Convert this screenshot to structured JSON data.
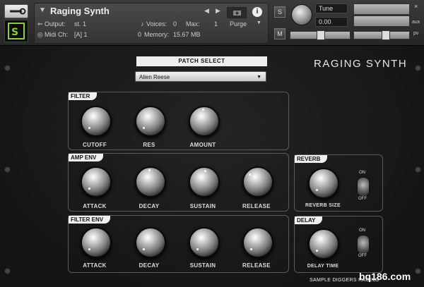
{
  "header": {
    "instrument_name": "Raging Synth",
    "output_label": "Output:",
    "output_value": "st. 1",
    "midi_label": "Midi Ch:",
    "midi_value": "[A]  1",
    "voices_label": "Voices:",
    "voices_value": "0",
    "max_label": "Max:",
    "max_value": "1",
    "memory_label": "Memory:",
    "memory_prefix": "0",
    "memory_value": "15.67 MB",
    "purge_label": "Purge",
    "s_label": "S",
    "m_label": "M",
    "tune_label": "Tune",
    "tune_value": "0.00",
    "aux_label": "aux",
    "pv_label": "pv"
  },
  "panel": {
    "title": "RAGING SYNTH",
    "patch_select_label": "PATCH SELECT",
    "patch_value": "Alien Reese",
    "filter": {
      "label": "FILTER",
      "knobs": [
        "CUTOFF",
        "RES",
        "AMOUNT"
      ]
    },
    "amp_env": {
      "label": "AMP ENV",
      "knobs": [
        "ATTACK",
        "DECAY",
        "SUSTAIN",
        "RELEASE"
      ]
    },
    "filter_env": {
      "label": "FILTER ENV",
      "knobs": [
        "ATTACK",
        "DECAY",
        "SUSTAIN",
        "RELEASE"
      ]
    },
    "reverb": {
      "label": "REVERB",
      "knob": "REVERB SIZE",
      "on_label": "ON",
      "off_label": "OFF"
    },
    "delay": {
      "label": "DELAY",
      "knob": "DELAY TIME",
      "on_label": "ON",
      "off_label": "OFF"
    },
    "footer": "SAMPLE DIGGERS RAGING",
    "watermark": "bq186.com"
  },
  "colors": {
    "background": "#141414",
    "header": "#303030",
    "label_bg": "#f0f0f0",
    "section_border": "#5a5a5a"
  }
}
